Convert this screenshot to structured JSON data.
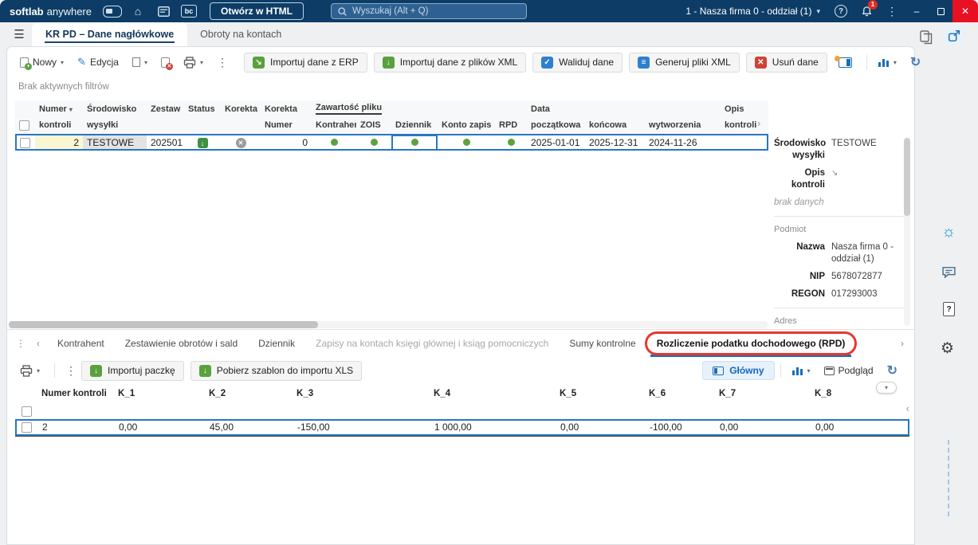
{
  "colors": {
    "navy": "#0d3d66",
    "accent": "#1c6eb4",
    "green": "#58a13c",
    "red": "#cf4236",
    "sel": "#2777c4",
    "ann": "#e8372e",
    "orange-dot": "#f0a23c"
  },
  "icons": {
    "hamburger": "☰",
    "home": "⌂",
    "chevron_down": "▾",
    "chevron_left": "‹",
    "chevron_right": "›",
    "more_vertical": "⋮",
    "minimize": "–",
    "close": "✕",
    "help": "?",
    "check": "✓",
    "x": "✕",
    "arrow_down": "↓",
    "lines": "≡",
    "refresh": "↻",
    "edit_pencil": "✎",
    "sort_indicator": "▾",
    "bulb": "☼",
    "gear": "⚙",
    "expand": "↘"
  },
  "titlebar": {
    "app_name_bold": "softlab",
    "app_name_light": "anywhere",
    "bc_badge": "bc",
    "open_html_button": "Otwórz w HTML",
    "search_placeholder": "Wyszukaj (Alt + Q)",
    "company_selector": "1 - Nasza firma 0 - oddział (1)",
    "notification_count": "1"
  },
  "tabs": {
    "items": [
      {
        "label": "KR PD – Dane nagłówkowe",
        "active": true
      },
      {
        "label": "Obroty na kontach",
        "active": false
      }
    ]
  },
  "toolbar": {
    "nowy": "Nowy",
    "edycja": "Edycja",
    "actions": [
      "Importuj dane z ERP",
      "Importuj dane z plików XML",
      "Waliduj dane",
      "Generuj pliki XML",
      "Usuń dane"
    ]
  },
  "filter_status": "Brak aktywnych filtrów",
  "main_grid": {
    "groups": {
      "zawartosc": "Zawartość pliku",
      "data": "Data"
    },
    "cols": {
      "numer1": "Numer",
      "numer2": "kontroli",
      "srod1": "Środowisko",
      "srod2": "wysyłki",
      "zestaw": "Zestaw",
      "status": "Status",
      "korekta": "Korekta",
      "kornum1": "Korekta",
      "kornum2": "Numer",
      "kontrahent": "Kontrahent",
      "zois": "ZOIS",
      "dziennik": "Dziennik",
      "konto": "Konto zapis",
      "rpd": "RPD",
      "pocz": "początkowa",
      "konc": "końcowa",
      "wytw": "wytworzenia",
      "opis1": "Opis",
      "opis2": "kontroli"
    },
    "row": {
      "numer": "2",
      "srodowisko": "TESTOWE",
      "zestaw": "202501",
      "korekta_numer": "0",
      "poczatkowa": "2025-01-01",
      "koncowa": "2025-12-31",
      "wytworzenia": "2024-11-26"
    }
  },
  "detail": {
    "srodowisko_label": "Środowisko wysyłki",
    "srodowisko_value": "TESTOWE",
    "opis_label": "Opis kontroli",
    "empty_text": "brak danych",
    "podmiot_header": "Podmiot",
    "nazwa_label": "Nazwa",
    "nazwa_value": "Nasza firma 0 - oddział (1)",
    "nip_label": "NIP",
    "nip_value": "5678072877",
    "regon_label": "REGON",
    "regon_value": "017293003",
    "adres_header": "Adres"
  },
  "bottom_tabs": {
    "items": [
      {
        "label": "Kontrahent"
      },
      {
        "label": "Zestawienie obrotów i sald"
      },
      {
        "label": "Dziennik"
      },
      {
        "label": "Zapisy na kontach księgi głównej i ksiąg pomocniczych",
        "muted": true
      },
      {
        "label": "Sumy kontrolne"
      },
      {
        "label": "Rozliczenie podatku dochodowego (RPD)",
        "active": true,
        "annotated": true
      }
    ]
  },
  "bottom_toolbar": {
    "importuj_paczke": "Importuj paczkę",
    "pobierz_szablon": "Pobierz szablon do importu XLS",
    "glowny": "Główny",
    "podglad": "Podgląd"
  },
  "bottom_grid": {
    "columns": [
      "Numer kontroli",
      "K_1",
      "K_2",
      "K_3",
      "K_4",
      "K_5",
      "K_6",
      "K_7",
      "K_8"
    ],
    "row": [
      "2",
      "0,00",
      "45,00",
      "-150,00",
      "1 000,00",
      "0,00",
      "-100,00",
      "0,00",
      "0,00"
    ]
  }
}
